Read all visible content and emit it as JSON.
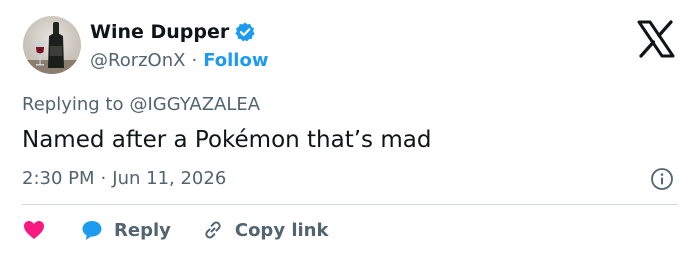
{
  "author": {
    "display_name": "Wine Dupper",
    "handle": "@RorzOnX",
    "separator": "·",
    "follow_label": "Follow",
    "verified": true
  },
  "reply_context": {
    "prefix": "Replying to",
    "to_handle": "@IGGYAZALEA"
  },
  "tweet": {
    "text": "Named after a Pokémon that’s mad",
    "time": "2:30 PM",
    "separator": "·",
    "date": "Jun 11, 2026"
  },
  "actions": {
    "reply_label": "Reply",
    "copy_link_label": "Copy link"
  },
  "icons": {
    "brand": "x-logo-icon",
    "verified": "verified-badge-icon",
    "info": "info-icon",
    "like": "heart-icon",
    "reply": "speech-bubble-icon",
    "copy": "link-icon"
  },
  "colors": {
    "accent": "#1d9bf0",
    "like": "#f91880",
    "text": "#0f1419",
    "muted": "#536471",
    "divider": "#cfd9de"
  }
}
